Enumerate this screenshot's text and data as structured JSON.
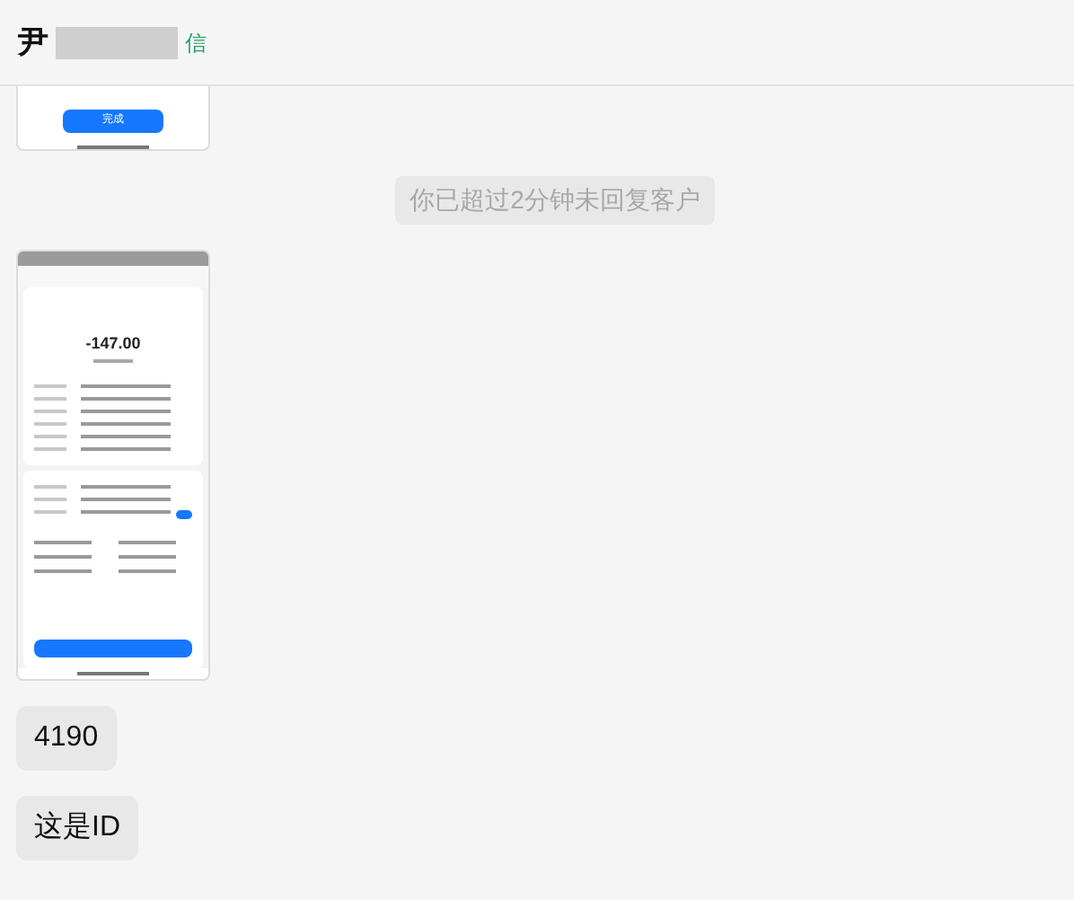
{
  "header": {
    "title_start": "尹",
    "title_end": "信"
  },
  "messages": [
    {
      "kind": "image_tail",
      "button": "完成"
    },
    {
      "kind": "notice",
      "text": "你已超过2分钟未回复客户"
    },
    {
      "kind": "image",
      "amount": "-147.00"
    },
    {
      "kind": "text",
      "text": "4190"
    },
    {
      "kind": "text",
      "text": "这是ID"
    }
  ]
}
